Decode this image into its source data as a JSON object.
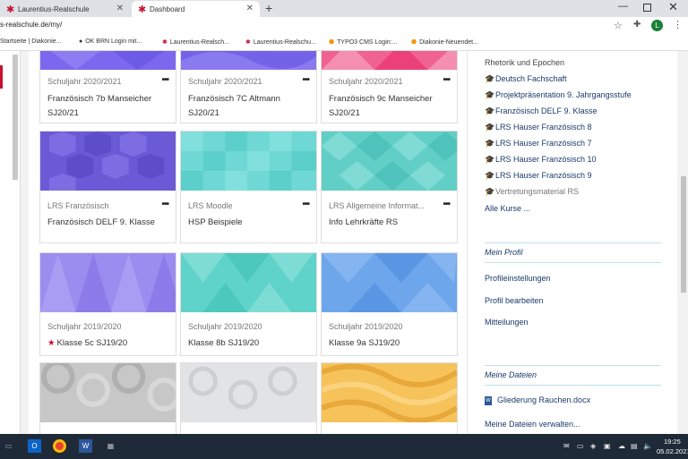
{
  "browser": {
    "tabs": [
      {
        "label": "Laurentius-Realschule",
        "active": false
      },
      {
        "label": "Dashboard",
        "active": true
      }
    ],
    "new_tab": "+",
    "url": "s-realschule.de/my/",
    "profile_initial": "L",
    "bookmarks": [
      {
        "icon": "grid-icon",
        "label": "Startseite | Diakonie..."
      },
      {
        "icon": "globe-icon",
        "label": "OK BRN Login mit..."
      },
      {
        "icon": "star-icon",
        "label": "Laurentius-Realsch..."
      },
      {
        "icon": "star-icon",
        "label": "Laurentius-Realschu..."
      },
      {
        "icon": "typo3-icon",
        "label": "TYPO3 CMS Login:..."
      },
      {
        "icon": "typo3-icon",
        "label": "Diakonie-Neuendet..."
      }
    ]
  },
  "courses": [
    {
      "category": "Schuljahr 2020/2021",
      "name": "Französisch 7b Manseicher SJ20/21",
      "favorite": false,
      "pattern": "purple"
    },
    {
      "category": "Schuljahr 2020/2021",
      "name": "Französisch 7C Altmann SJ20/21",
      "favorite": false,
      "pattern": "purple"
    },
    {
      "category": "Schuljahr 2020/2021",
      "name": "Französisch 9c Manseicher SJ20/21",
      "favorite": false,
      "pattern": "pink"
    },
    {
      "category": "LRS Französisch",
      "name": "Französisch DELF 9. Klasse",
      "favorite": false,
      "pattern": "hex-purple"
    },
    {
      "category": "LRS Moodle",
      "name": "HSP Beispiele",
      "favorite": false,
      "pattern": "teal-squares"
    },
    {
      "category": "LRS Allgemeine Informat...",
      "name": "Info Lehrkräfte RS",
      "favorite": false,
      "pattern": "teal-diamonds"
    },
    {
      "category": "Schuljahr 2019/2020",
      "name": "Klasse 5c SJ19/20",
      "favorite": true,
      "pattern": "lavender-triangles"
    },
    {
      "category": "Schuljahr 2019/2020",
      "name": "Klasse 8b SJ19/20",
      "favorite": false,
      "pattern": "teal-triangles"
    },
    {
      "category": "Schuljahr 2019/2020",
      "name": "Klasse 9a SJ19/20",
      "favorite": false,
      "pattern": "blue-triangles"
    },
    {
      "category": "",
      "name": "",
      "favorite": false,
      "pattern": "grey-circles"
    },
    {
      "category": "",
      "name": "",
      "favorite": false,
      "pattern": "light-circles"
    },
    {
      "category": "",
      "name": "",
      "favorite": false,
      "pattern": "yellow-waves"
    }
  ],
  "card_menu": "•••",
  "sidebar": {
    "course_list": [
      {
        "label": "Rhetorik und Epochen",
        "icon": false,
        "muted": true
      },
      {
        "label": "Deutsch Fachschaft",
        "icon": true,
        "muted": false
      },
      {
        "label": "Projektpräsentation 9. Jahrgangsstufe",
        "icon": true,
        "muted": false
      },
      {
        "label": "Französisch DELF 9. Klasse",
        "icon": true,
        "muted": false
      },
      {
        "label": "LRS Hauser Französisch 8",
        "icon": true,
        "muted": false
      },
      {
        "label": "LRS Hauser Französisch 7",
        "icon": true,
        "muted": false
      },
      {
        "label": "LRS Hauser Französisch 10",
        "icon": true,
        "muted": false
      },
      {
        "label": "LRS Hauser Französisch 9",
        "icon": true,
        "muted": false
      },
      {
        "label": "Vertretungsmaterial RS",
        "icon": true,
        "muted": true
      }
    ],
    "all_courses": "Alle Kurse ...",
    "profile_title": "Mein Profil",
    "profile_links": [
      "Profileinstellungen",
      "Profil bearbeiten",
      "Mitteilungen"
    ],
    "files_title": "Meine Dateien",
    "file_name": "Gliederung Rauchen.docx",
    "manage_files": "Meine Dateien verwalten..."
  },
  "taskbar": {
    "time": "19:25",
    "date": "05.02.2021"
  }
}
